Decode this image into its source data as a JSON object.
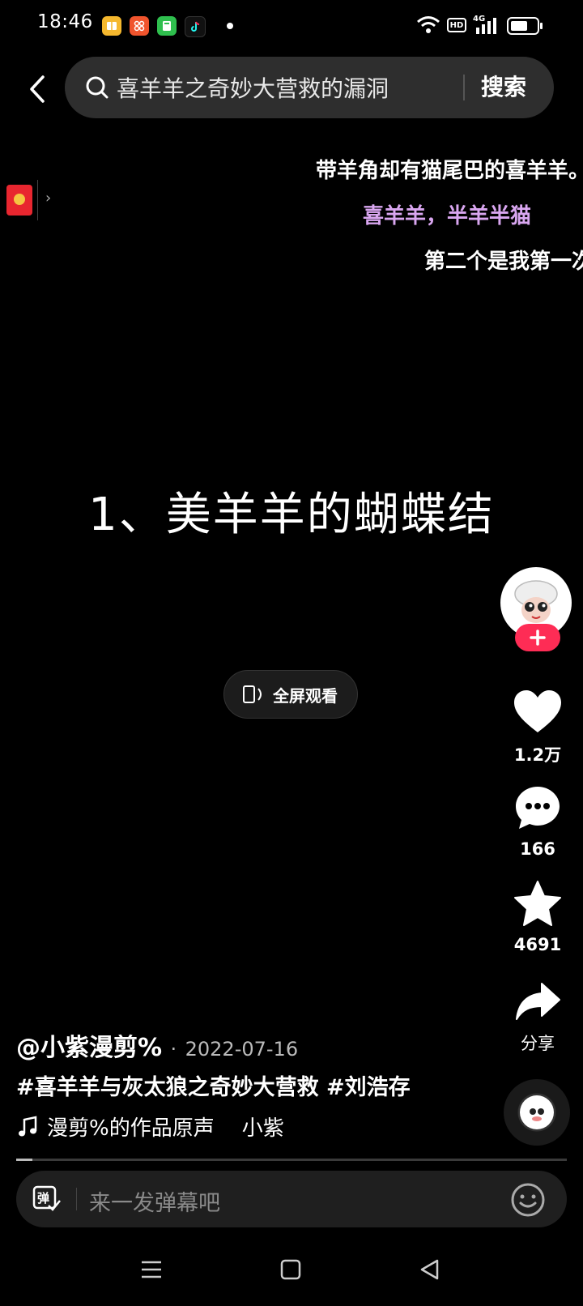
{
  "status_bar": {
    "time": "18:46",
    "network": "4G",
    "hd": "HD"
  },
  "search": {
    "query": "喜羊羊之奇妙大营救的漏洞",
    "submit_label": "搜索"
  },
  "danmaku": [
    {
      "text": "带羊角却有猫尾巴的喜羊羊。",
      "color": "#ffffff"
    },
    {
      "text": "喜羊羊，半羊半猫",
      "color": "#d9a6f0"
    },
    {
      "text": "第二个是我第一次",
      "color": "#ffffff"
    }
  ],
  "video": {
    "overlay_title": "1、美羊羊的蝴蝶结",
    "fullscreen_label": "全屏观看",
    "progress": 0.03
  },
  "actions": {
    "likes": "1.2万",
    "comments": "166",
    "favorites": "4691",
    "share_label": "分享"
  },
  "post": {
    "author": "@小紫漫剪%",
    "date_sep": "·",
    "date": "2022-07-16",
    "hashtags": "#喜羊羊与灰太狼之奇妙大营救 #刘浩存",
    "music_title": "漫剪%的作品原声",
    "music_artist": "小紫"
  },
  "comment_bar": {
    "danmu_label": "弹",
    "placeholder": "来一发弹幕吧"
  },
  "colors": {
    "accent": "#fe2c55",
    "danmaku_purple": "#d9a6f0"
  }
}
